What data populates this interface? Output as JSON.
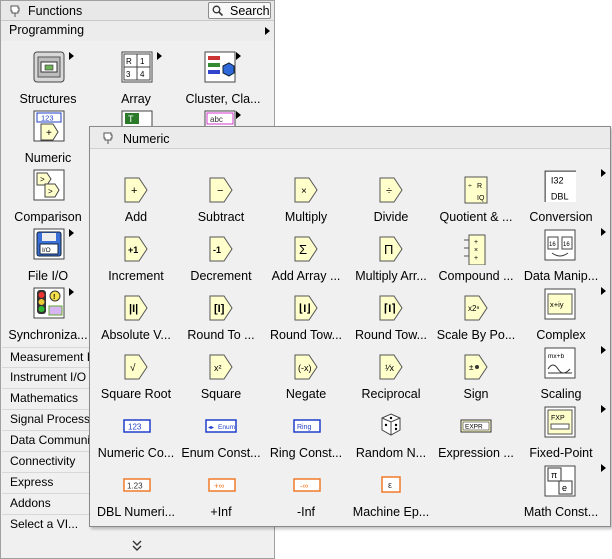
{
  "functions_palette": {
    "title": "Functions",
    "search_label": "Search",
    "section": "Programming",
    "programming_items": [
      {
        "label": "Structures",
        "icon": "structures-icon"
      },
      {
        "label": "Array",
        "icon": "array-icon"
      },
      {
        "label": "Cluster, Cla...",
        "icon": "cluster-icon"
      },
      {
        "label": "Numeric",
        "icon": "numeric-icon"
      },
      {
        "label": "Comparison",
        "icon": "comparison-icon"
      },
      {
        "label": "File I/O",
        "icon": "file-io-icon"
      },
      {
        "label": "Synchroniza...",
        "icon": "synchronization-icon"
      }
    ],
    "categories": [
      "Measurement I/",
      "Instrument I/O",
      "Mathematics",
      "Signal Processin",
      "Data Communi",
      "Connectivity",
      "Express",
      "Addons",
      "Select a VI..."
    ]
  },
  "numeric_palette": {
    "title": "Numeric",
    "items": [
      "Add",
      "Subtract",
      "Multiply",
      "Divide",
      "Quotient & ...",
      "Conversion",
      "Increment",
      "Decrement",
      "Add Array ...",
      "Multiply Arr...",
      "Compound ...",
      "Data Manip...",
      "Absolute V...",
      "Round To ...",
      "Round Tow...",
      "Round Tow...",
      "Scale By Po...",
      "Complex",
      "Square Root",
      "Square",
      "Negate",
      "Reciprocal",
      "Sign",
      "Scaling",
      "Numeric Co...",
      "Enum Const...",
      "Ring Const...",
      "Random N...",
      "Expression ...",
      "Fixed-Point",
      "DBL Numeri...",
      "+Inf",
      "-Inf",
      "Machine Ep...",
      "",
      "Math Const..."
    ]
  },
  "icon_glyphs": {
    "conversion_top": "I32",
    "conversion_bottom": "DBL",
    "numeric_constant": "123",
    "enum_constant": "Enum",
    "ring_constant": "Ring",
    "expression": "EXPR",
    "dbl_numeric": "1.23",
    "plus_inf": "+∞",
    "minus_inf": "-∞",
    "machine_eps": "ε",
    "fixed_point": "FXP",
    "math_const_pi": "π",
    "math_const_e": "e",
    "structures": "abc",
    "numeric_123": "123"
  },
  "colors": {
    "function_yellow": "#ffffcc",
    "constant_blue": "#1f3fc9",
    "constant_orange": "#f07a2a",
    "enum_pink": "#d038d0"
  }
}
